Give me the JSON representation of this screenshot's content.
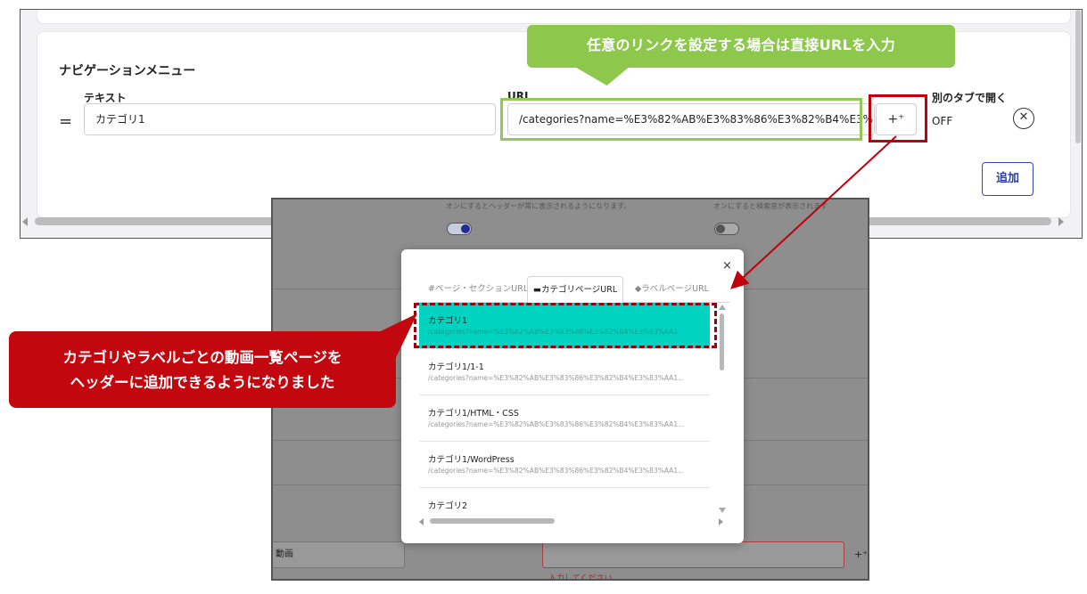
{
  "nav_menu": {
    "title": "ナビゲーションメニュー",
    "col_text": "テキスト",
    "col_url": "URL",
    "col_new_tab": "別のタブで開く",
    "drag_handle": "=",
    "text_value": "カテゴリ1",
    "url_value": "/categories?name=%E3%82%AB%E3%83%86%E3%82%B4%E3%83",
    "picker_icon": "sparkle-icon",
    "picker_glyph": "+⁺",
    "new_tab_value": "OFF",
    "remove_glyph": "✕",
    "add_label": "追加"
  },
  "callouts": {
    "top": "任意のリンクを設定する場合は直接URLを入力",
    "red_line1": "カテゴリやラベルごとの動画一覧ページを",
    "red_line2": "ヘッダーに追加できるようになりました"
  },
  "background_settings": {
    "hint_left": "オンにするとヘッダーが常に表示されるようになります。",
    "hint_right": "オンにすると検索窓が表示されます",
    "toggle_left_on": true,
    "toggle_right_on": false,
    "video_field": "動画",
    "error": "入力してください。"
  },
  "modal": {
    "close_glyph": "×",
    "tabs": [
      {
        "label": "#ページ・セクションURL",
        "active": false
      },
      {
        "label": "▬カテゴリページURL",
        "active": true
      },
      {
        "label": "◆ラベルページURL",
        "active": false
      }
    ],
    "items": [
      {
        "name": "カテゴリ1",
        "url": "/categories?name=%E3%82%AB%E3%83%86%E3%82%B4%E3%83%AA1",
        "selected": true
      },
      {
        "name": "カテゴリ1/1-1",
        "url": "/categories?name=%E3%82%AB%E3%83%86%E3%82%B4%E3%83%AA1...",
        "selected": false
      },
      {
        "name": "カテゴリ1/HTML・CSS",
        "url": "/categories?name=%E3%82%AB%E3%83%86%E3%82%B4%E3%83%AA1...",
        "selected": false
      },
      {
        "name": "カテゴリ1/WordPress",
        "url": "/categories?name=%E3%82%AB%E3%83%86%E3%82%B4%E3%83%AA1...",
        "selected": false
      },
      {
        "name": "カテゴリ2",
        "url": "",
        "selected": false
      }
    ]
  },
  "colors": {
    "green_callout": "#8dc84c",
    "red_callout": "#c2070f",
    "selected_item": "#00d4c0",
    "add_button": "#2a3fa8"
  }
}
